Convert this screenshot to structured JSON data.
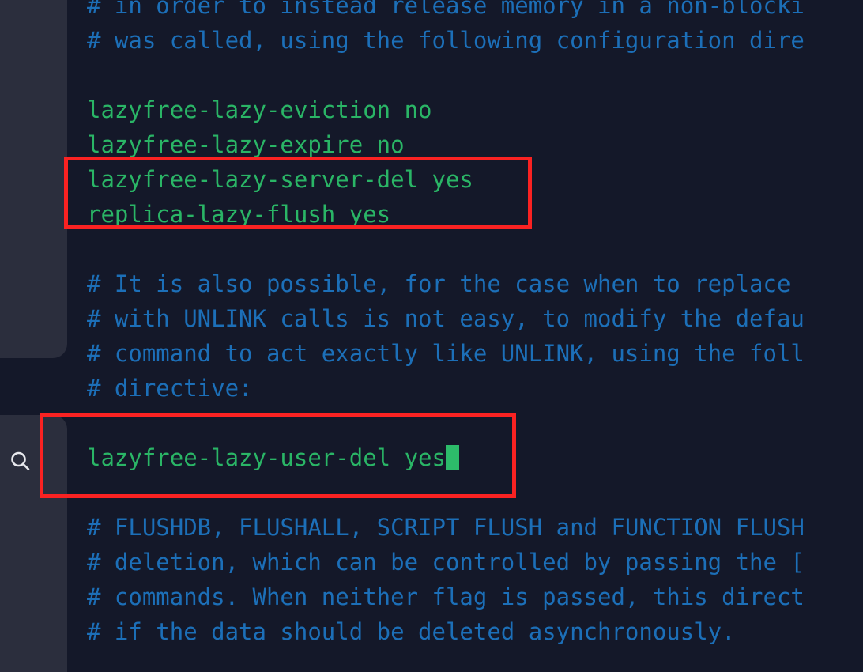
{
  "app": {
    "background_color": "#141829",
    "sidebar_color": "#2b2e3d",
    "comment_color": "#1c6fb8",
    "key_color": "#2ab566",
    "value_color": "#2ab566",
    "cursor_color": "#2dbb6a",
    "highlight_color": "#fa2222"
  },
  "sidebar": {
    "search_icon_name": "search-icon"
  },
  "editor": {
    "lines": [
      {
        "type": "comment",
        "text": "# in order to instead release memory in a non-blocki"
      },
      {
        "type": "comment",
        "text": "# was called, using the following configuration dire"
      },
      {
        "type": "blank",
        "text": " "
      },
      {
        "type": "setting",
        "text": "lazyfree-lazy-eviction no"
      },
      {
        "type": "setting",
        "text": "lazyfree-lazy-expire no"
      },
      {
        "type": "setting",
        "text": "lazyfree-lazy-server-del yes"
      },
      {
        "type": "setting",
        "text": "replica-lazy-flush yes"
      },
      {
        "type": "blank",
        "text": " "
      },
      {
        "type": "comment",
        "text": "# It is also possible, for the case when to replace"
      },
      {
        "type": "comment",
        "text": "# with UNLINK calls is not easy, to modify the defau"
      },
      {
        "type": "comment",
        "text": "# command to act exactly like UNLINK, using the foll"
      },
      {
        "type": "comment",
        "text": "# directive:"
      },
      {
        "type": "blank",
        "text": " "
      },
      {
        "type": "setting-cursor",
        "text": "lazyfree-lazy-user-del yes"
      },
      {
        "type": "blank",
        "text": " "
      },
      {
        "type": "comment",
        "text": "# FLUSHDB, FLUSHALL, SCRIPT FLUSH and FUNCTION FLUSH"
      },
      {
        "type": "comment",
        "text": "# deletion, which can be controlled by passing the ["
      },
      {
        "type": "comment",
        "text": "# commands. When neither flag is passed, this direct"
      },
      {
        "type": "comment",
        "text": "# if the data should be deleted asynchronously."
      }
    ]
  },
  "annotations": {
    "box_1_label": "highlight-lazyfree-server-del-and-replica-lazy-flush",
    "box_2_label": "highlight-lazyfree-lazy-user-del"
  }
}
